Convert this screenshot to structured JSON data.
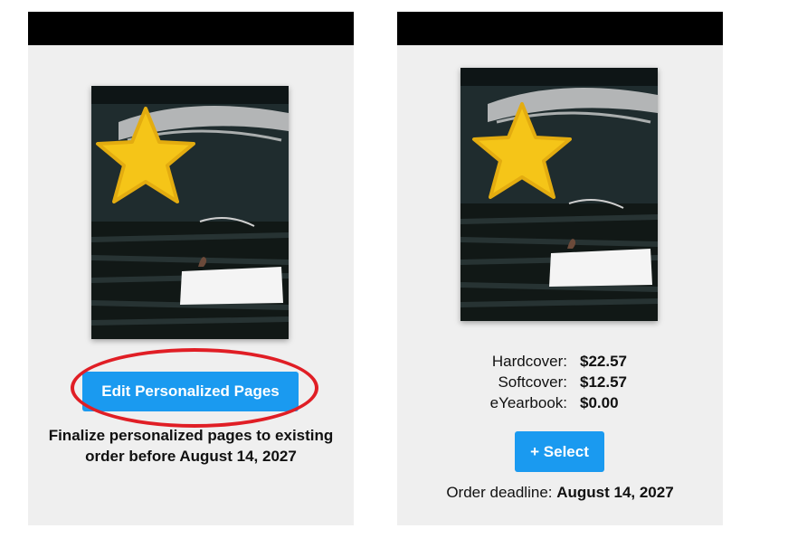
{
  "left_card": {
    "button_label": "Edit Personalized Pages",
    "note": "Finalize personalized pages to existing order before August 14, 2027"
  },
  "right_card": {
    "prices": [
      {
        "label": "Hardcover:",
        "value": "$22.57"
      },
      {
        "label": "Softcover:",
        "value": "$12.57"
      },
      {
        "label": "eYearbook:",
        "value": "$0.00"
      }
    ],
    "select_label": "+ Select",
    "deadline_label": "Order deadline:",
    "deadline_date": "August 14, 2027"
  },
  "colors": {
    "accent": "#1a9af0",
    "highlight_ring": "#e01e25",
    "card_bg": "#efefef",
    "header_bar": "#000000"
  },
  "icons": [
    "star-sticker",
    "yearbook-cover-art"
  ]
}
